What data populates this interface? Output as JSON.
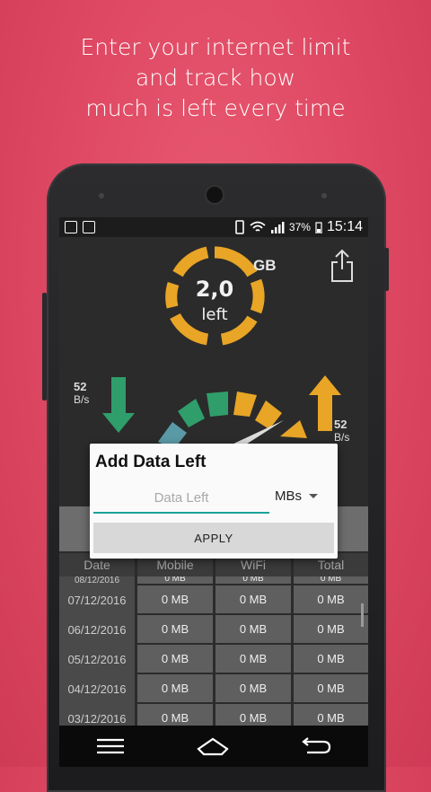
{
  "promo": {
    "line1": "Enter your internet limit",
    "line2": "and track how",
    "line3": "much is left every time"
  },
  "status_bar": {
    "battery": "37%",
    "time": "15:14"
  },
  "gauge": {
    "value": "2,0",
    "label": "left",
    "unit": "GB"
  },
  "speed": {
    "download_value": "52",
    "download_unit": "B/s",
    "upload_value": "52",
    "upload_unit": "B/s"
  },
  "dialog": {
    "title": "Add Data Left",
    "input_placeholder": "Data Left",
    "unit_selected": "MBs",
    "apply_label": "APPLY"
  },
  "table": {
    "headers": [
      "Date",
      "Mobile",
      "WiFi",
      "Total"
    ],
    "partial_row": [
      "08/12/2016",
      "0 MB",
      "0 MB",
      "0 MB"
    ],
    "rows": [
      [
        "07/12/2016",
        "0 MB",
        "0 MB",
        "0 MB"
      ],
      [
        "06/12/2016",
        "0 MB",
        "0 MB",
        "0 MB"
      ],
      [
        "05/12/2016",
        "0 MB",
        "0 MB",
        "0 MB"
      ],
      [
        "04/12/2016",
        "0 MB",
        "0 MB",
        "0 MB"
      ],
      [
        "03/12/2016",
        "0 MB",
        "0 MB",
        "0 MB"
      ]
    ]
  },
  "colors": {
    "background": "#e04a64",
    "gauge_ring": "#e8a526",
    "accent_teal": "#1aa39a",
    "download_arrow": "#2f9e6a",
    "upload_arrow": "#e8a526"
  },
  "icons": {
    "menu": "menu-icon",
    "home": "home-icon",
    "back": "back-icon",
    "share": "share-icon"
  }
}
